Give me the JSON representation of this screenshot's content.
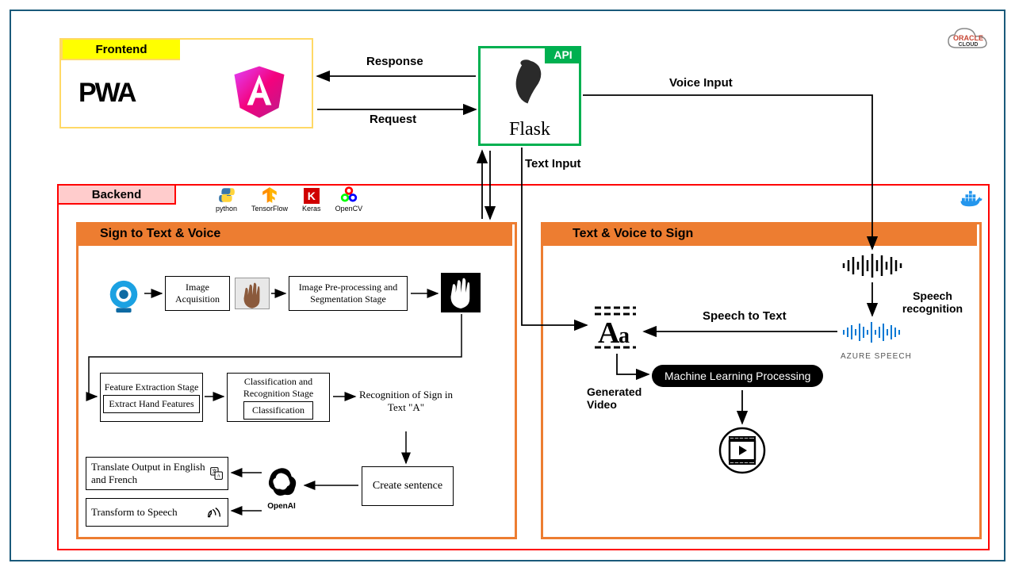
{
  "frontend": {
    "title": "Frontend",
    "pwa": "PWA"
  },
  "api": {
    "title": "API",
    "product": "Flask"
  },
  "backend": {
    "title": "Backend",
    "tech": [
      "python",
      "TensorFlow",
      "Keras",
      "OpenCV"
    ]
  },
  "s2t": {
    "title": "Sign to Text & Voice",
    "step_image_acq": "Image Acquisition",
    "step_preproc": "Image Pre-processing and Segmentation Stage",
    "step_feat_stage": "Feature Extraction Stage",
    "step_feat_sub": "Extract Hand Features",
    "step_class_stage": "Classification and Recognition Stage",
    "step_class_sub": "Classification",
    "step_recog": "Recognition of Sign in Text \"A\"",
    "step_create": "Create sentence",
    "step_openai": "OpenAI",
    "step_translate": "Translate Output in English and French",
    "step_speech": "Transform to Speech"
  },
  "t2s": {
    "title": "Text & Voice to Sign",
    "speech_rec": "Speech recognition",
    "speech_to_text": "Speech to Text",
    "azure": "AZURE SPEECH",
    "ml": "Machine Learning Processing",
    "gen_video": "Generated Video"
  },
  "arrows": {
    "response": "Response",
    "request": "Request",
    "voice_input": "Voice Input",
    "text_input": "Text Input"
  },
  "cloud": {
    "brand": "ORACLE",
    "sub": "CLOUD"
  }
}
